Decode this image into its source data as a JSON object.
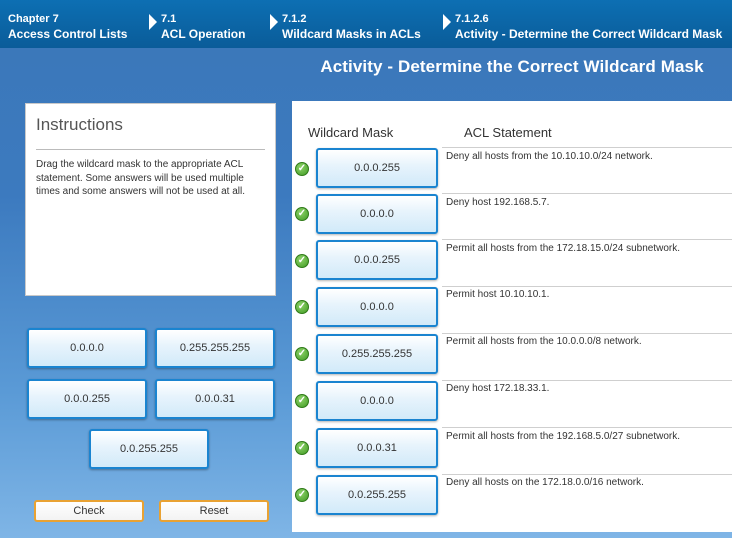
{
  "breadcrumb": [
    {
      "number": "Chapter 7",
      "label": "Access Control Lists"
    },
    {
      "number": "7.1",
      "label": "ACL Operation"
    },
    {
      "number": "7.1.2",
      "label": "Wildcard Masks in ACLs"
    },
    {
      "number": "7.1.2.6",
      "label": "Activity - Determine the Correct Wildcard Mask"
    }
  ],
  "activity_title": "Activity - Determine the Correct Wildcard Mask",
  "instructions": {
    "title": "Instructions",
    "text": "Drag the wildcard mask to the appropriate ACL statement. Some answers will be used multiple times and some answers will not be used at all."
  },
  "mask_bank": [
    "0.0.0.0",
    "0.255.255.255",
    "0.0.0.255",
    "0.0.0.31",
    "0.0.255.255"
  ],
  "table": {
    "col_mask": "Wildcard Mask",
    "col_statement": "ACL Statement",
    "rows": [
      {
        "mask": "0.0.0.255",
        "statement": "Deny all hosts from the 10.10.10.0/24 network."
      },
      {
        "mask": "0.0.0.0",
        "statement": "Deny host 192.168.5.7."
      },
      {
        "mask": "0.0.0.255",
        "statement": "Permit all hosts from the 172.18.15.0/24 subnetwork."
      },
      {
        "mask": "0.0.0.0",
        "statement": "Permit host 10.10.10.1."
      },
      {
        "mask": "0.255.255.255",
        "statement": "Permit all hosts from the 10.0.0.0/8 network."
      },
      {
        "mask": "0.0.0.0",
        "statement": "Deny host 172.18.33.1."
      },
      {
        "mask": "0.0.0.31",
        "statement": "Permit all hosts from the 192.168.5.0/27 subnetwork."
      },
      {
        "mask": "0.0.255.255",
        "statement": "Deny all hosts on the 172.18.0.0/16 network."
      }
    ]
  },
  "buttons": {
    "check": "Check",
    "reset": "Reset"
  },
  "icons": {
    "row_status": "checkmark-icon",
    "breadcrumb_separator": "triangle-right-icon"
  },
  "colors": {
    "header": "#0a5c99",
    "accent_border": "#1a84d0",
    "button_border": "#e9a233",
    "check_green": "#3f9a23"
  }
}
